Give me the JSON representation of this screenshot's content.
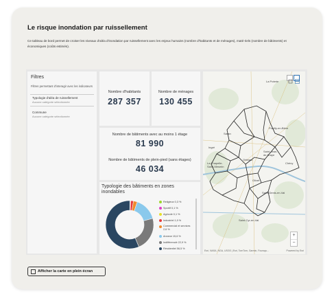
{
  "page": {
    "title": "Le risque inondation par ruissellement",
    "description": "Ce tableau de bord permet de croiser les niveaux d'aléa d'inondation par ruissellement avec les enjeux humains (nombre d'habitants et de ménages), maté-riels (nombre de bâtiments) et économiques (coûts estimés)."
  },
  "filters": {
    "title": "Filtres",
    "hint": "Filtres permettant d'interagir avec les indicateurs",
    "groups": [
      {
        "label": "Typologie d'aléa de ruissellement",
        "value": "Aucune catégorie sélectionnée"
      },
      {
        "label": "Commune",
        "value": "Aucune catégorie sélectionnée"
      }
    ]
  },
  "kpis": {
    "habitants": {
      "label": "Nombre d'habitants",
      "value": "287 357"
    },
    "menages": {
      "label": "Nombre de ménages",
      "value": "130 455"
    },
    "bat_etage": {
      "label": "Nombre de bâtiments avec au moins 1 étage",
      "value": "81 990"
    },
    "bat_plain": {
      "label": "Nombre de bâtiments de plein-pied (sans étages)",
      "value": "46 034"
    }
  },
  "typology": {
    "title": "Typologie des bâtiments en zones inondables",
    "legend": [
      {
        "label": "Religieux 0,3 %",
        "color": "#9ed62b",
        "value": 0.3
      },
      {
        "label": "Sportif 0,1 %",
        "color": "#e03ec4",
        "value": 0.1
      },
      {
        "label": "Agricole 0,1 %",
        "color": "#e8e026",
        "value": 0.1
      },
      {
        "label": "Industriel 1,9 %",
        "color": "#e6393b",
        "value": 1.9
      },
      {
        "label": "Commercial et services 2,6 %",
        "color": "#f08a2c",
        "value": 2.6
      },
      {
        "label": "Annexe 15,6 %",
        "color": "#8ac9ec",
        "value": 15.6
      },
      {
        "label": "Indifférencié 22,9 %",
        "color": "#7a7a7a",
        "value": 22.9
      },
      {
        "label": "Résidentiel 56,5 %",
        "color": "#2a4661",
        "value": 56.5
      }
    ]
  },
  "map": {
    "labels": [
      "La Poterie",
      "Pouilly-en-Bière",
      "Saint-Cyr-en-Val",
      "Orléans",
      "Saran",
      "Olivet",
      "Chécy",
      "Ingré",
      "La Chapelle-Saint-Mesmin",
      "Saint-Jean-de-Braye",
      "Saint-Denis-en-Val"
    ],
    "attribution_left": "Esri, NASA, NGA, USGS | Esri, TomTom, Garmin, Foursqu...",
    "attribution_right": "Powered by Esri",
    "zoom_in": "+",
    "zoom_out": "−"
  },
  "fullscreen_button": {
    "label": "Afficher la carte en plein écran"
  }
}
